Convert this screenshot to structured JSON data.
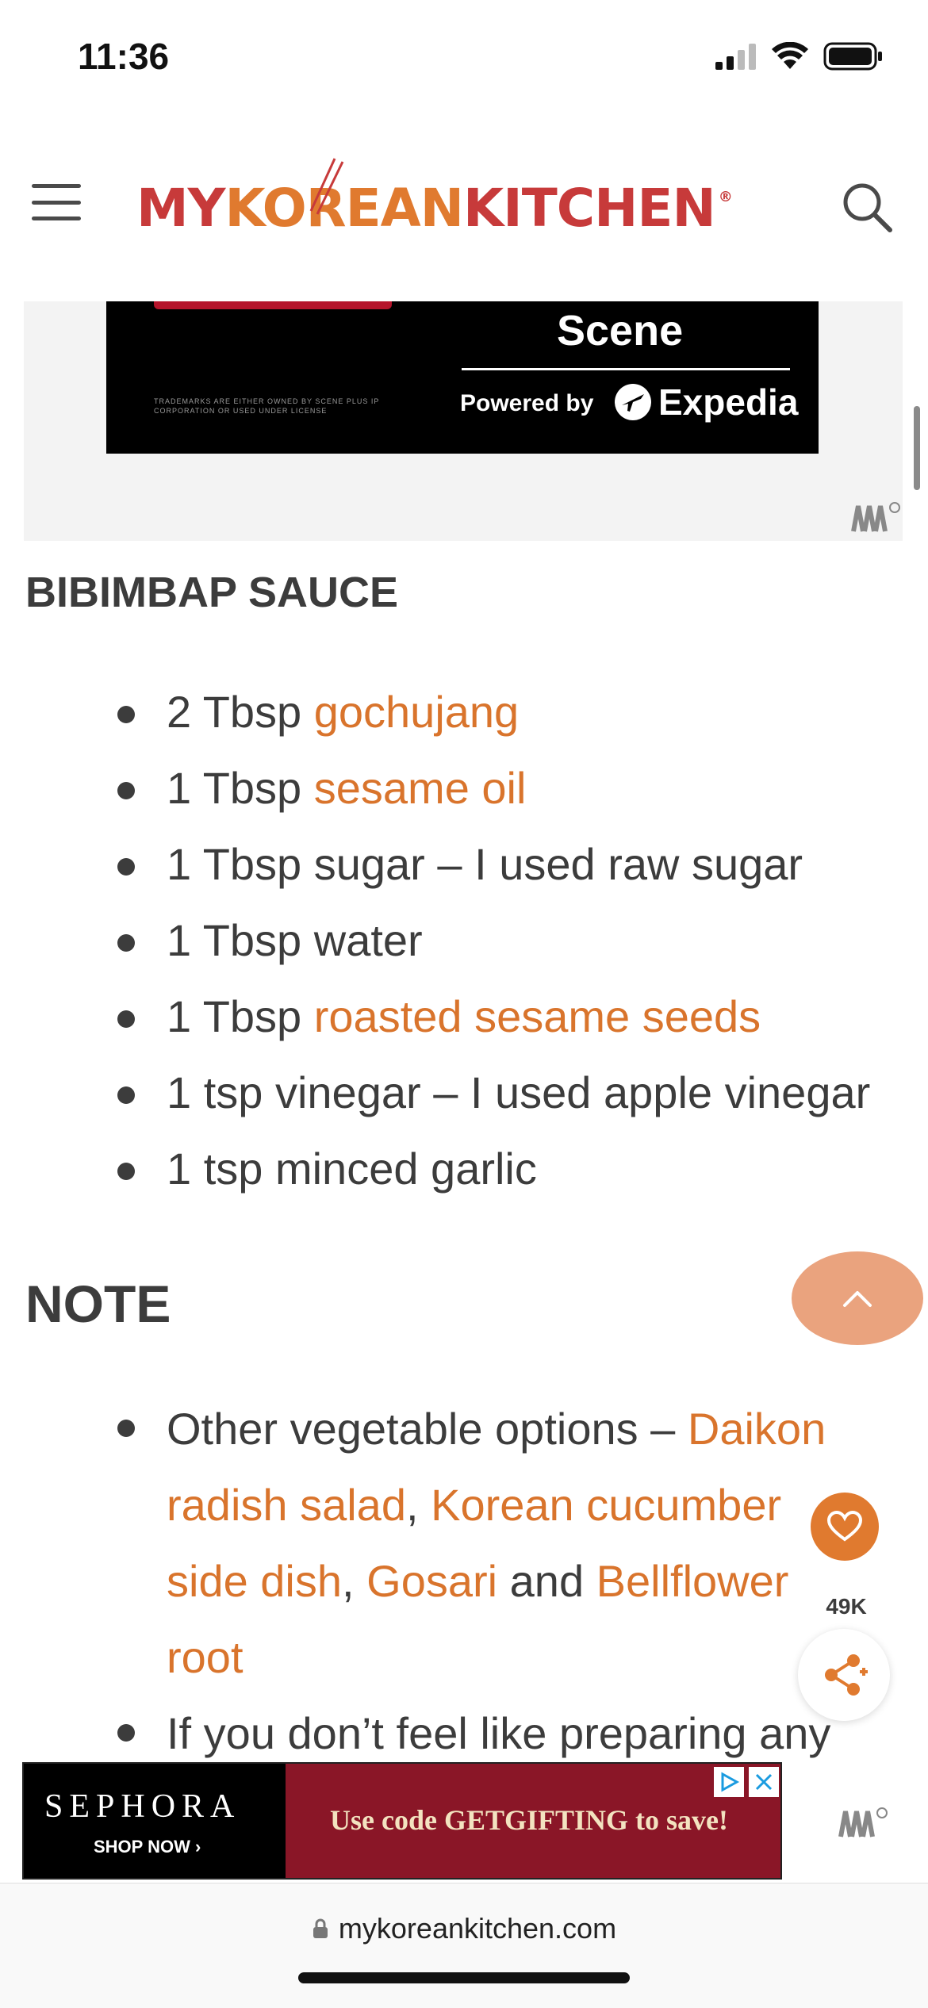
{
  "status_bar": {
    "time": "11:36"
  },
  "header": {
    "logo": {
      "part1": "MY ",
      "part2": "KOREAN ",
      "part3": "KITCHEN",
      "mark": "®"
    },
    "menu_icon": "hamburger-icon",
    "search_icon": "search-icon"
  },
  "ad_top": {
    "brand": "Scene",
    "powered_by": "Powered by",
    "partner": "Expedia",
    "fine_print": "TRADEMARKS ARE EITHER OWNED BY SCENE PLUS IP CORPORATION OR USED UNDER LICENSE"
  },
  "sauce": {
    "heading": "BIBIMBAP SAUCE",
    "items": [
      {
        "text": "2 Tbsp ",
        "link": "gochujang",
        "after": ""
      },
      {
        "text": "1 Tbsp ",
        "link": "sesame oil",
        "after": ""
      },
      {
        "text": "1 Tbsp sugar – I used raw sugar",
        "link": "",
        "after": ""
      },
      {
        "text": "1 Tbsp water",
        "link": "",
        "after": ""
      },
      {
        "text": "1 Tbsp ",
        "link": "roasted sesame seeds",
        "after": ""
      },
      {
        "text": "1 tsp vinegar – I used apple vinegar",
        "link": "",
        "after": ""
      },
      {
        "text": "1 tsp minced garlic",
        "link": "",
        "after": ""
      }
    ]
  },
  "note": {
    "heading": "NOTE",
    "item1": {
      "prefix": "Other vegetable options – ",
      "link1": "Daikon radish salad",
      "sep1": ", ",
      "link2": "Korean cucumber side dish",
      "sep2": ", ",
      "link3": "Gosari",
      "sep3": " and ",
      "link4": "Bellflower root"
    },
    "item2": {
      "text": "If you don’t feel like preparing any"
    }
  },
  "floating": {
    "count": "49K"
  },
  "ad_bottom": {
    "brand": "SEPHORA",
    "cta": "SHOP NOW ›",
    "promo": "Use code GETGIFTING to save!"
  },
  "browser": {
    "url": "mykoreankitchen.com"
  },
  "colors": {
    "link": "#d9742c",
    "brand_red": "#c73a3a",
    "brand_orange": "#e07a2f",
    "top_button": "#eaa37e"
  }
}
